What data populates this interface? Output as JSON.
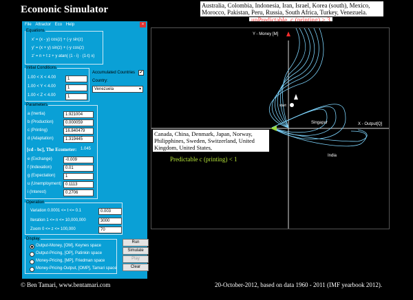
{
  "header": {
    "title": "Econonic Simulator",
    "countries_unpredictable": "Australia, Colombia, Indonesia, Iran, Israel, Korea (south), Mexico, Morocco, Pakistan, Peru, Russia, South Africa, Turkey, Venezuela.",
    "unpredictable_label": "unPredictable, c  (printing) > 3"
  },
  "menu": {
    "items": [
      "File",
      "Attractor",
      "Eco",
      "Help"
    ]
  },
  "equations": {
    "legend": "Equations",
    "lines": [
      "x' = (x - y) cos(z) + (-y sin(z)",
      "y' = (x + y) sin(z) + (-y cos(z)",
      "z' = n + t z + y atan( (1 - i) · (1-t) x)"
    ]
  },
  "initial": {
    "legend": "Initial Conditions",
    "rows": [
      {
        "label": "1.00 <  X < 4.00",
        "value": "1"
      },
      {
        "label": "1.00 <  Y < 4.00",
        "value": "1"
      },
      {
        "label": "1.00 <  Z < 4.00",
        "value": "1"
      }
    ],
    "accumulated": "Accumulated Countries",
    "accumulated_checked": "✔",
    "country_label": "Country:",
    "country_value": "Venezuela"
  },
  "parameters": {
    "legend": "Parameters",
    "rows": [
      {
        "label": "a  (Inertia)",
        "value": "1.921004"
      },
      {
        "label": "b  (Production)",
        "value": "0.000059"
      },
      {
        "label": "c  (Printing)",
        "value": "16.840479"
      },
      {
        "label": "d  (Adaptation)",
        "value": "1.319445"
      }
    ],
    "ecometer": "[cd - bc], The Ecometer:",
    "ecometer_value": "1.045",
    "rows2": [
      {
        "label": "e  (Exchange)",
        "value": "-0.009"
      },
      {
        "label": "f  (Indexation)",
        "value": "0.01"
      },
      {
        "label": "g  (Expectation)",
        "value": "1"
      },
      {
        "label": "u  (Unemployment)",
        "value": "0.1113"
      },
      {
        "label": "i  (Interest)",
        "value": "0.2706"
      }
    ]
  },
  "operation": {
    "legend": "Operation",
    "rows": [
      {
        "label": "Variation    0.0001 <= t <= 0.1",
        "value": "0.003"
      },
      {
        "label": "Iteration      1 <= n <= 10,000,000",
        "value": "3000"
      },
      {
        "label": "Zoom          0 <= z <= 100,000",
        "value": "70"
      }
    ]
  },
  "display": {
    "legend": "Display",
    "options": [
      "Output-Money, [OM], Keynes space",
      "Output-Pricing, [OP], Patinkin space",
      "Money-Pricing, [MP], Friedman space",
      "Money-Pricing-Output, [OMP], Tamari space"
    ],
    "buttons": [
      "Run",
      "Simulate",
      "Play",
      "Clear"
    ]
  },
  "plot": {
    "y_axis_label": "Y - Money [M]",
    "x_axis_label": "X - Output[Q]",
    "labels": [
      "start",
      "Singapur",
      "India"
    ],
    "countries_predictable": "Canada, China, Denmark, Japan, Norway, Philipphines, Sweden, Switzerland, United Kingdom, United States,",
    "predictable_label": "Predictable c (printing) < 1",
    "colors": {
      "curve": "#7fd6ff",
      "arrow": "#9ad93b",
      "red": "#ff2d2d"
    }
  },
  "footer": {
    "left": "©  Ben Tamari,   www.bentamari.com",
    "right": "20-October-2012, based on data 1960 - 2011 (IMF yearbook 2012)."
  }
}
